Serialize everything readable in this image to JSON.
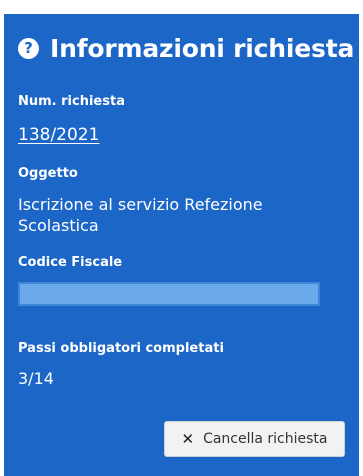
{
  "panel": {
    "title": "Informazioni richiesta",
    "help_icon_glyph": "?",
    "accent_color": "#1c66c8"
  },
  "fields": {
    "num_richiesta_label": "Num. richiesta",
    "num_richiesta_value": "138/2021",
    "oggetto_label": "Oggetto",
    "oggetto_value": "Iscrizione al servizio Refezione Scolastica",
    "codice_fiscale_label": "Codice Fiscale",
    "codice_fiscale_value": "",
    "passi_label": "Passi obbligatori completati",
    "passi_value": "3/14"
  },
  "actions": {
    "cancel_label": "Cancella richiesta",
    "cancel_icon": "close-icon"
  }
}
